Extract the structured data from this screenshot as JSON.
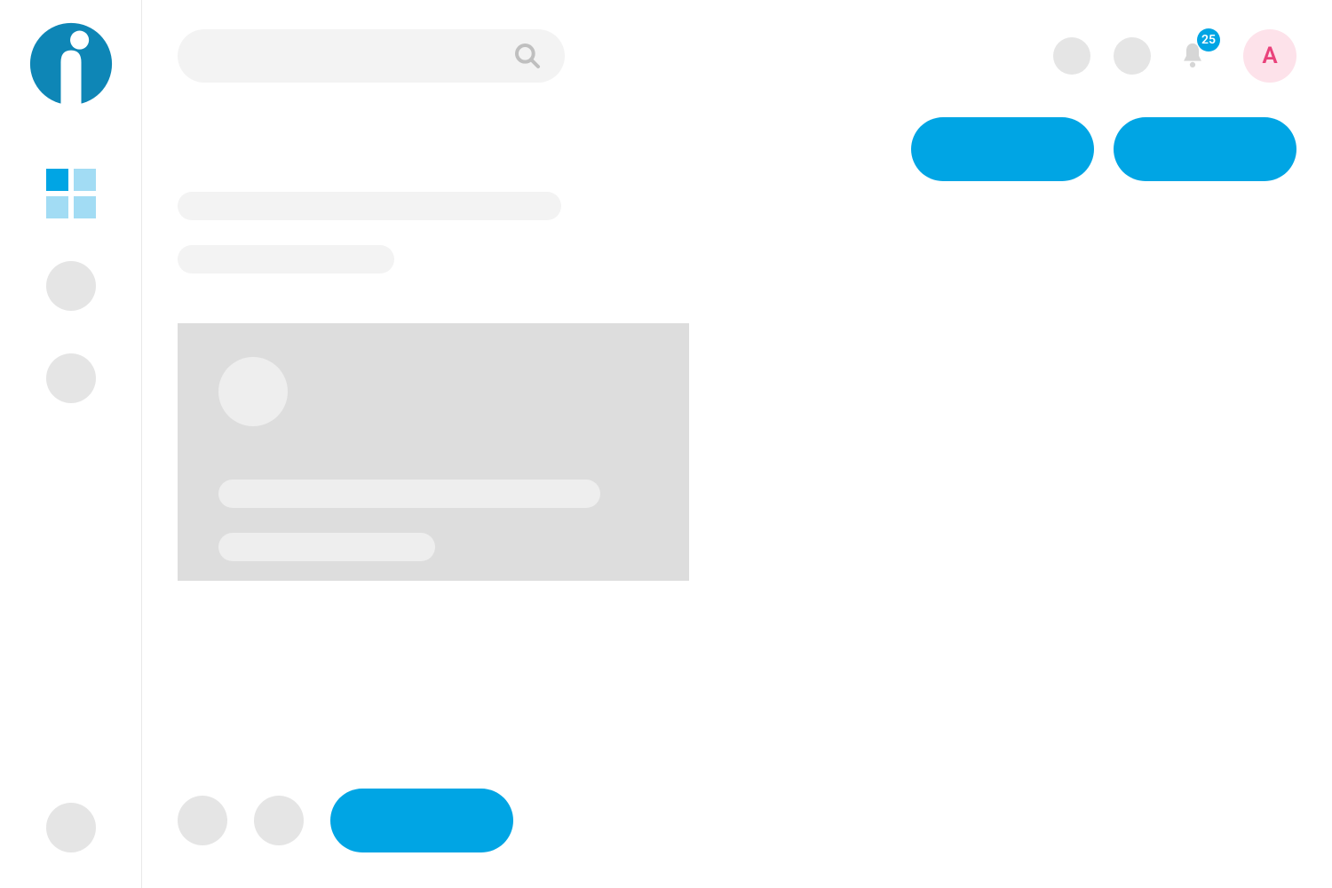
{
  "header": {
    "notification_count": "25",
    "avatar_initial": "A",
    "search_placeholder": "",
    "icons": {
      "search": "search-icon",
      "bell": "bell-icon"
    }
  },
  "sidebar": {
    "logo": "app-logo",
    "items": [
      {
        "name": "dashboard",
        "type": "grid",
        "active": true
      },
      {
        "name": "nav-placeholder-1",
        "type": "circle"
      },
      {
        "name": "nav-placeholder-2",
        "type": "circle"
      }
    ],
    "bottom": {
      "name": "nav-bottom-placeholder"
    }
  },
  "actions": {
    "primary_label": "",
    "secondary_label": ""
  },
  "content": {
    "title_line": "",
    "subtitle_line": "",
    "card": {
      "line1": "",
      "line2": ""
    }
  },
  "bottom": {
    "button_label": ""
  },
  "colors": {
    "accent": "#00a5e4",
    "accent_light": "#a2dcf4",
    "skeleton": "#f3f3f3",
    "skeleton_dark": "#dddddd",
    "avatar_bg": "#fde2ea",
    "avatar_fg": "#e9427b"
  }
}
